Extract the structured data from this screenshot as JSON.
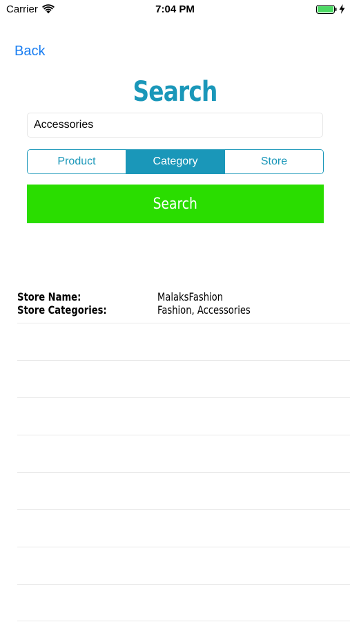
{
  "status_bar": {
    "carrier": "Carrier",
    "time": "7:04 PM",
    "icons": [
      "wifi-icon",
      "battery-icon",
      "charging-bolt-icon"
    ],
    "battery_color": "#4cd964"
  },
  "nav": {
    "back_label": "Back"
  },
  "title": "Search",
  "search": {
    "value": "Accessories",
    "placeholder": ""
  },
  "segments": {
    "items": [
      {
        "label": "Product"
      },
      {
        "label": "Category"
      },
      {
        "label": "Store"
      }
    ],
    "selected": "Category"
  },
  "search_button": {
    "label": "Search"
  },
  "results": [
    {
      "name_label": "Store Name:",
      "name_value": "MalaksFashion",
      "categories_label": "Store Categories:",
      "categories_value": "Fashion, Accessories"
    }
  ],
  "colors": {
    "accent": "#1a97b9",
    "link": "#1a7ef2",
    "search_button": "#2add00"
  }
}
